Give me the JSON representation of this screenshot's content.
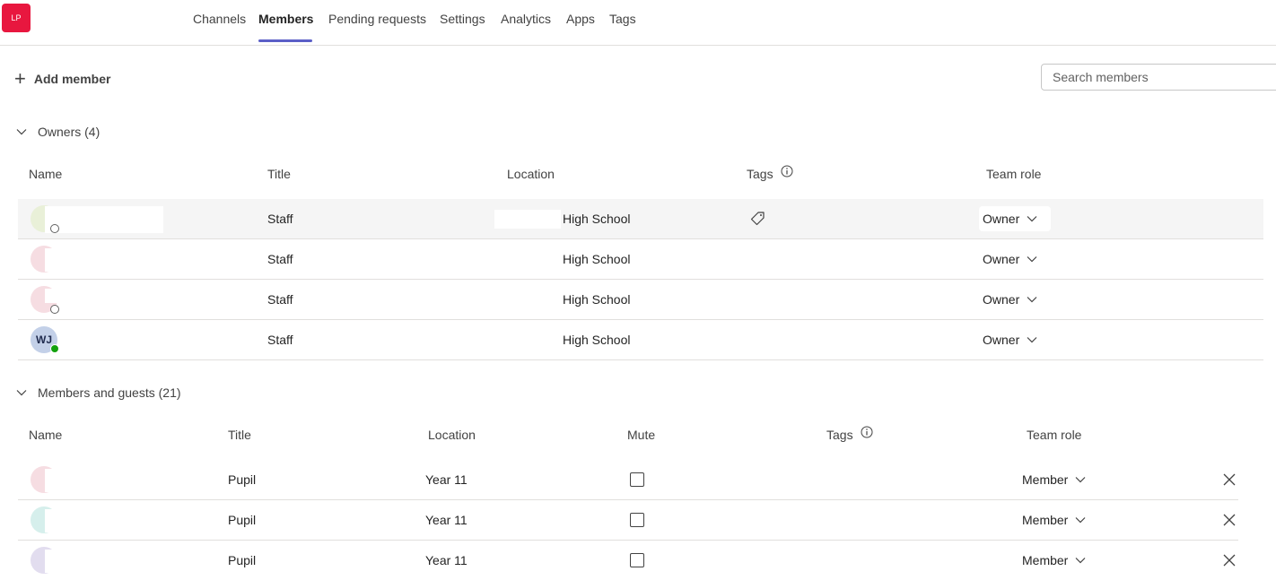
{
  "team": {
    "avatar_initials": "LP",
    "avatar_color": "#e8173f"
  },
  "tabs": [
    {
      "label": "Channels",
      "active": false
    },
    {
      "label": "Members",
      "active": true
    },
    {
      "label": "Pending requests",
      "active": false
    },
    {
      "label": "Settings",
      "active": false
    },
    {
      "label": "Analytics",
      "active": false
    },
    {
      "label": "Apps",
      "active": false
    },
    {
      "label": "Tags",
      "active": false
    }
  ],
  "toolbar": {
    "add_member_label": "Add member",
    "search_placeholder": "Search members"
  },
  "owners": {
    "header": "Owners (4)",
    "columns": {
      "name": "Name",
      "title": "Title",
      "location": "Location",
      "tags": "Tags",
      "team_role": "Team role"
    },
    "rows": [
      {
        "name": "",
        "initials": "",
        "title": "Staff",
        "location": "High School",
        "role": "Owner",
        "presence": "offline"
      },
      {
        "name": "",
        "initials": "",
        "title": "Staff",
        "location": "High School",
        "role": "Owner",
        "presence": "offline"
      },
      {
        "name": "",
        "initials": "",
        "title": "Staff",
        "location": "High School",
        "role": "Owner",
        "presence": "offline"
      },
      {
        "name": "",
        "initials": "WJ",
        "title": "Staff",
        "location": "High School",
        "role": "Owner",
        "presence": "available"
      }
    ]
  },
  "members": {
    "header": "Members and guests (21)",
    "columns": {
      "name": "Name",
      "title": "Title",
      "location": "Location",
      "mute": "Mute",
      "tags": "Tags",
      "team_role": "Team role"
    },
    "rows": [
      {
        "name": "",
        "title": "Pupil",
        "location": "Year 11",
        "role": "Member",
        "muted": false
      },
      {
        "name": "",
        "title": "Pupil",
        "location": "Year 11",
        "role": "Member",
        "muted": false
      },
      {
        "name": "",
        "title": "Pupil",
        "location": "Year 11",
        "role": "Member",
        "muted": false
      }
    ]
  },
  "colors": {
    "accent": "#5b5fc7",
    "row_hover": "#f5f5f5",
    "divider": "#e1dfdd"
  }
}
